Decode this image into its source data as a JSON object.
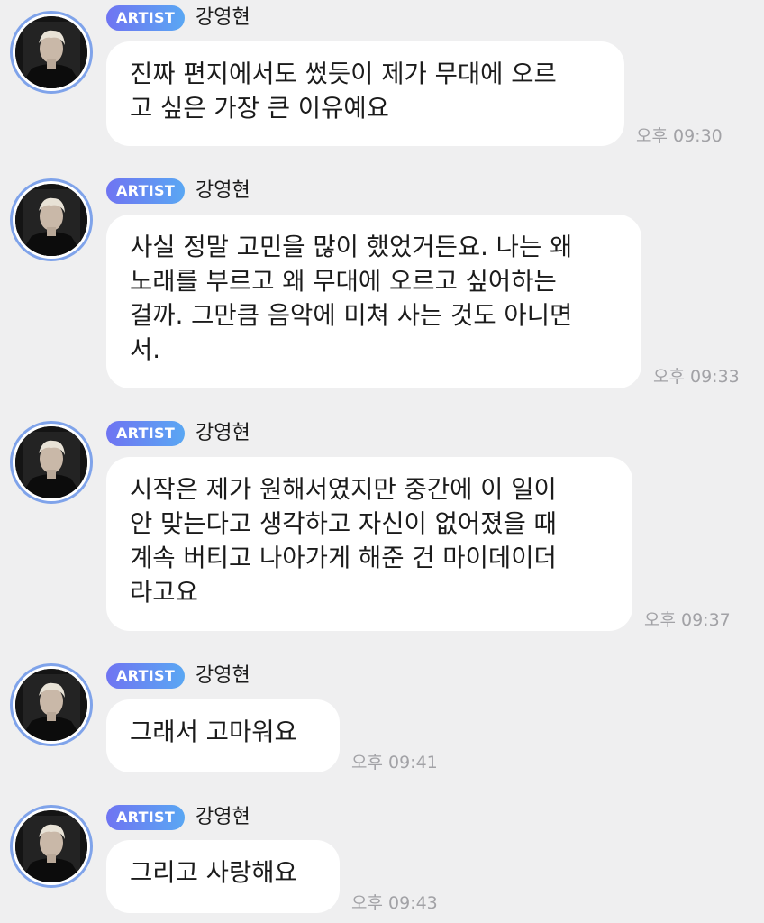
{
  "messages": [
    {
      "badge": "ARTIST",
      "sender": "강영현",
      "text": "진짜 편지에서도 썼듯이 제가 무대에 오르\n고 싶은 가장 큰 이유예요",
      "time": "오후 09:30",
      "avatar_icon": "artist-avatar"
    },
    {
      "badge": "ARTIST",
      "sender": "강영현",
      "text": "사실 정말 고민을 많이 했었거든요. 나는 왜\n노래를 부르고 왜 무대에 오르고 싶어하는\n걸까. 그만큼 음악에 미쳐 사는 것도 아니면\n서.",
      "time": "오후 09:33",
      "avatar_icon": "artist-avatar"
    },
    {
      "badge": "ARTIST",
      "sender": "강영현",
      "text": "시작은 제가 원해서였지만 중간에 이 일이\n안 맞는다고 생각하고 자신이 없어졌을 때\n계속 버티고 나아가게 해준 건 마이데이더\n라고요",
      "time": "오후 09:37",
      "avatar_icon": "artist-avatar"
    },
    {
      "badge": "ARTIST",
      "sender": "강영현",
      "text": "그래서 고마워요",
      "time": "오후 09:41",
      "avatar_icon": "artist-avatar"
    },
    {
      "badge": "ARTIST",
      "sender": "강영현",
      "text": "그리고 사랑해요",
      "time": "오후 09:43",
      "avatar_icon": "artist-avatar"
    }
  ],
  "colors": {
    "background": "#efeff0",
    "bubble": "#ffffff",
    "badge_start": "#6f74f2",
    "badge_end": "#5aa7f3",
    "avatar_ring": "#7fa3ea",
    "time_text": "#a2a2a6"
  }
}
